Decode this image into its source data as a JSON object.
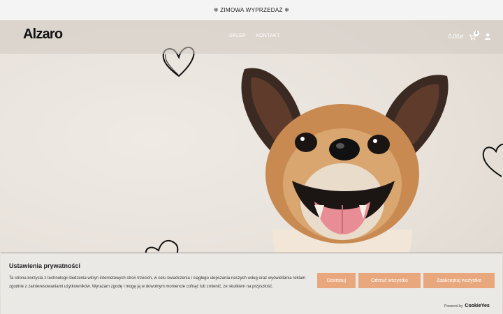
{
  "announcement": {
    "text": "❄ ZIMOWA WYPRZEDAŻ ❄"
  },
  "header": {
    "logo": "Alzaro",
    "nav": [
      "SKLEP",
      "KONTAKT"
    ],
    "cart_total": "0,00zł",
    "cart_count": "0"
  },
  "cookie_banner": {
    "title": "Ustawienia prywatności",
    "text": "Ta strona korzysta z technologii śledzenia witryn internetowych stron trzecich, w celu świadczenia i ciągłego ulepszania naszych usług oraz wyświetlania reklam zgodnie z zainteresowaniami użytkowników. Wyrażam zgodę i mogę ją w dowolnym momencie cofnąć lub zmienić, ze skutkiem na przyszłość.",
    "buttons": {
      "customize": "Dostosuj",
      "reject": "Odrzuć wszystko",
      "accept": "Zaakceptuj wszystko"
    },
    "powered_by": "Powered by",
    "powered_logo": "CookieYes"
  },
  "colors": {
    "accent": "#e9a77e",
    "background": "#ebe7e1"
  }
}
